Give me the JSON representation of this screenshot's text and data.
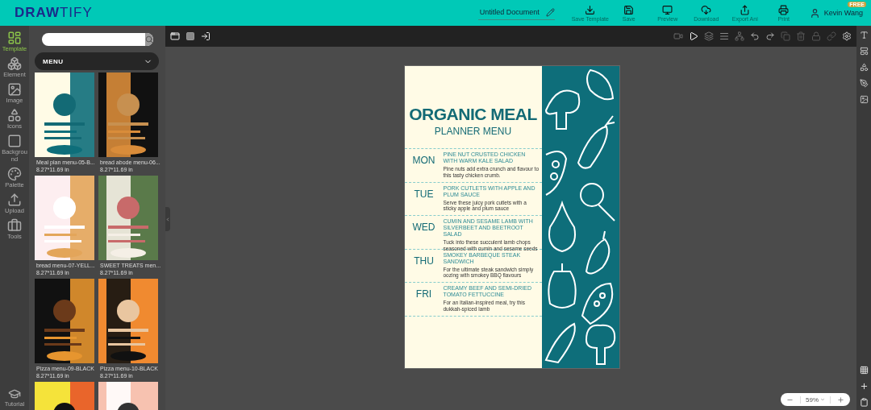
{
  "header": {
    "logo": {
      "bold": "DRAW",
      "light": "TIFY"
    },
    "document_title": "Untitled Document",
    "actions": [
      {
        "label": "Save Template"
      },
      {
        "label": "Save"
      },
      {
        "label": "Preview"
      },
      {
        "label": "Download"
      },
      {
        "label": "Export Ani"
      },
      {
        "label": "Print"
      }
    ],
    "user": {
      "name": "Kevin Wang",
      "badge": "FREE"
    }
  },
  "rail": {
    "items": [
      {
        "label": "Template",
        "selected": true
      },
      {
        "label": "Element",
        "selected": false
      },
      {
        "label": "Image",
        "selected": false
      },
      {
        "label": "Icons",
        "selected": false
      },
      {
        "label": "Background",
        "selected": false
      },
      {
        "label": "Palette",
        "selected": false
      },
      {
        "label": "Upload",
        "selected": false
      },
      {
        "label": "Tools",
        "selected": false
      }
    ],
    "tutorial": "Tutorial"
  },
  "panel": {
    "category": "MENU",
    "templates": [
      {
        "name": "Meal plan menu-05-B...",
        "size": "8.27*11.69 in"
      },
      {
        "name": "bread abode menu-06...",
        "size": "8.27*11.69 in"
      },
      {
        "name": "bread menu-07-YELL...",
        "size": "8.27*11.69 in"
      },
      {
        "name": "SWEET TREATS men...",
        "size": "8.27*11.69 in"
      },
      {
        "name": "Pizza menu-09-BLACK",
        "size": "8.27*11.69 in"
      },
      {
        "name": "Pizza menu-10-BLACK",
        "size": "8.27*11.69 in"
      },
      {
        "kind": "picture"
      },
      {
        "kind": "picture"
      }
    ]
  },
  "document": {
    "title": "ORGANIC MEAL",
    "subtitle": "PLANNER MENU",
    "days": [
      {
        "day": "MON",
        "dish": "PINE NUT CRUSTED CHICKEN WITH WARM KALE SALAD",
        "description": "Pine nuts add extra crunch and flavour to this tasty chicken crumb."
      },
      {
        "day": "TUE",
        "dish": "PORK CUTLETS WITH APPLE AND PLUM SAUCE",
        "description": "Serve these juicy pork cutlets with a sticky apple and plum sauce"
      },
      {
        "day": "WED",
        "dish": "CUMIN AND SESAME LAMB WITH SILVERBEET AND BEETROOT SALAD",
        "description": "Tuck into these succulent lamb chops seasoned with cumin and sesame seeds"
      },
      {
        "day": "THU",
        "dish": "SMOKEY BARBEQUE STEAK SANDWICH",
        "description": "For the ultimate steak sandwich simply oozing with smokey BBQ flavours"
      },
      {
        "day": "FRI",
        "dish": "CREAMY BEEF AND SEMI-DRIED TOMATO FETTUCCINE",
        "description": "For an Italian-inspired meal, try this dukkah-spiced lamb"
      }
    ]
  },
  "zoom": {
    "value": "59%"
  }
}
